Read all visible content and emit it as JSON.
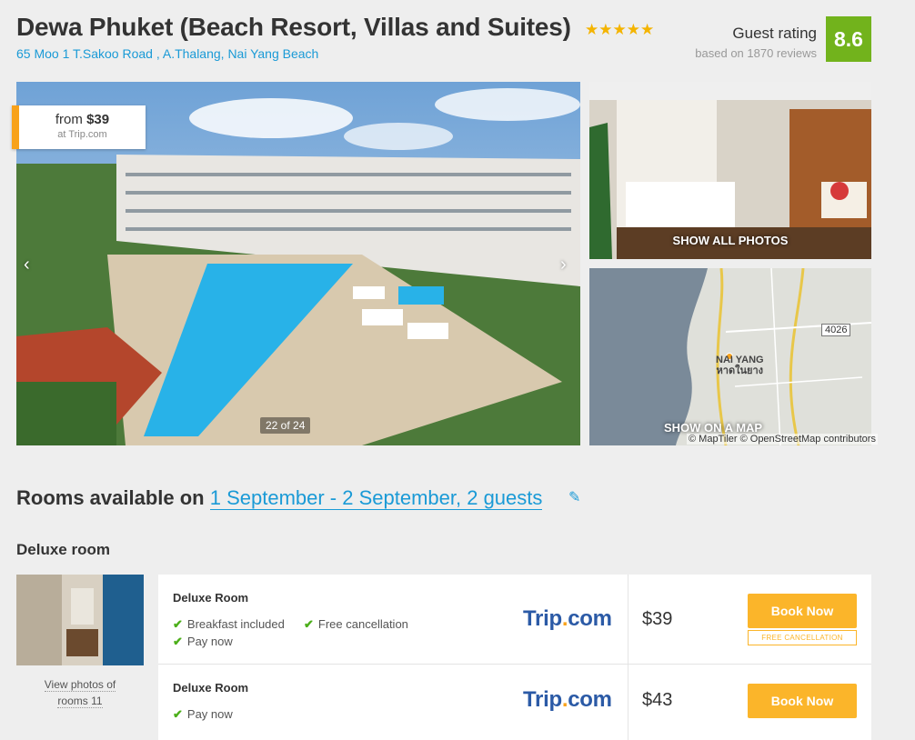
{
  "hotel": {
    "name": "Dewa Phuket (Beach Resort, Villas and Suites)",
    "stars": "★★★★★",
    "address": "65 Moo 1 T.Sakoo Road , A.Thalang, Nai Yang Beach"
  },
  "rating": {
    "label": "Guest rating",
    "reviews": "based on 1870 reviews",
    "score": "8.6",
    "badge_color": "#72b31c"
  },
  "gallery": {
    "price_from": "from",
    "price_value": "$39",
    "price_source": "at Trip.com",
    "prev_icon": "‹",
    "next_icon": "›",
    "counter": "22 of 24",
    "show_all_photos": "SHOW ALL PHOTOS",
    "show_on_map": "SHOW ON A MAP",
    "map_credit": "© MapTiler © OpenStreetMap contributors",
    "map_place_en": "NAI YANG",
    "map_place_th": "หาดในยาง",
    "road_number": "4026"
  },
  "availability": {
    "prefix": "Rooms available on ",
    "dates": "1 September - 2 September, 2 guests",
    "edit_icon": "✎"
  },
  "room": {
    "type": "Deluxe room",
    "view_photos_line1": "View photos of",
    "view_photos_line2": "rooms 11",
    "offers": [
      {
        "name": "Deluxe Room",
        "features": [
          "Breakfast included",
          "Free cancellation",
          "Pay now"
        ],
        "provider_a": "Trip",
        "provider_dot": ".",
        "provider_b": "com",
        "price": "$39",
        "book_label": "Book Now",
        "free_cancellation_label": "FREE CANCELLATION"
      },
      {
        "name": "Deluxe Room",
        "features": [
          "Pay now"
        ],
        "provider_a": "Trip",
        "provider_dot": ".",
        "provider_b": "com",
        "price": "$43",
        "book_label": "Book Now"
      }
    ]
  },
  "colors": {
    "accent": "#1a9ad6",
    "book": "#fbb52a",
    "check": "#4caf1a"
  }
}
